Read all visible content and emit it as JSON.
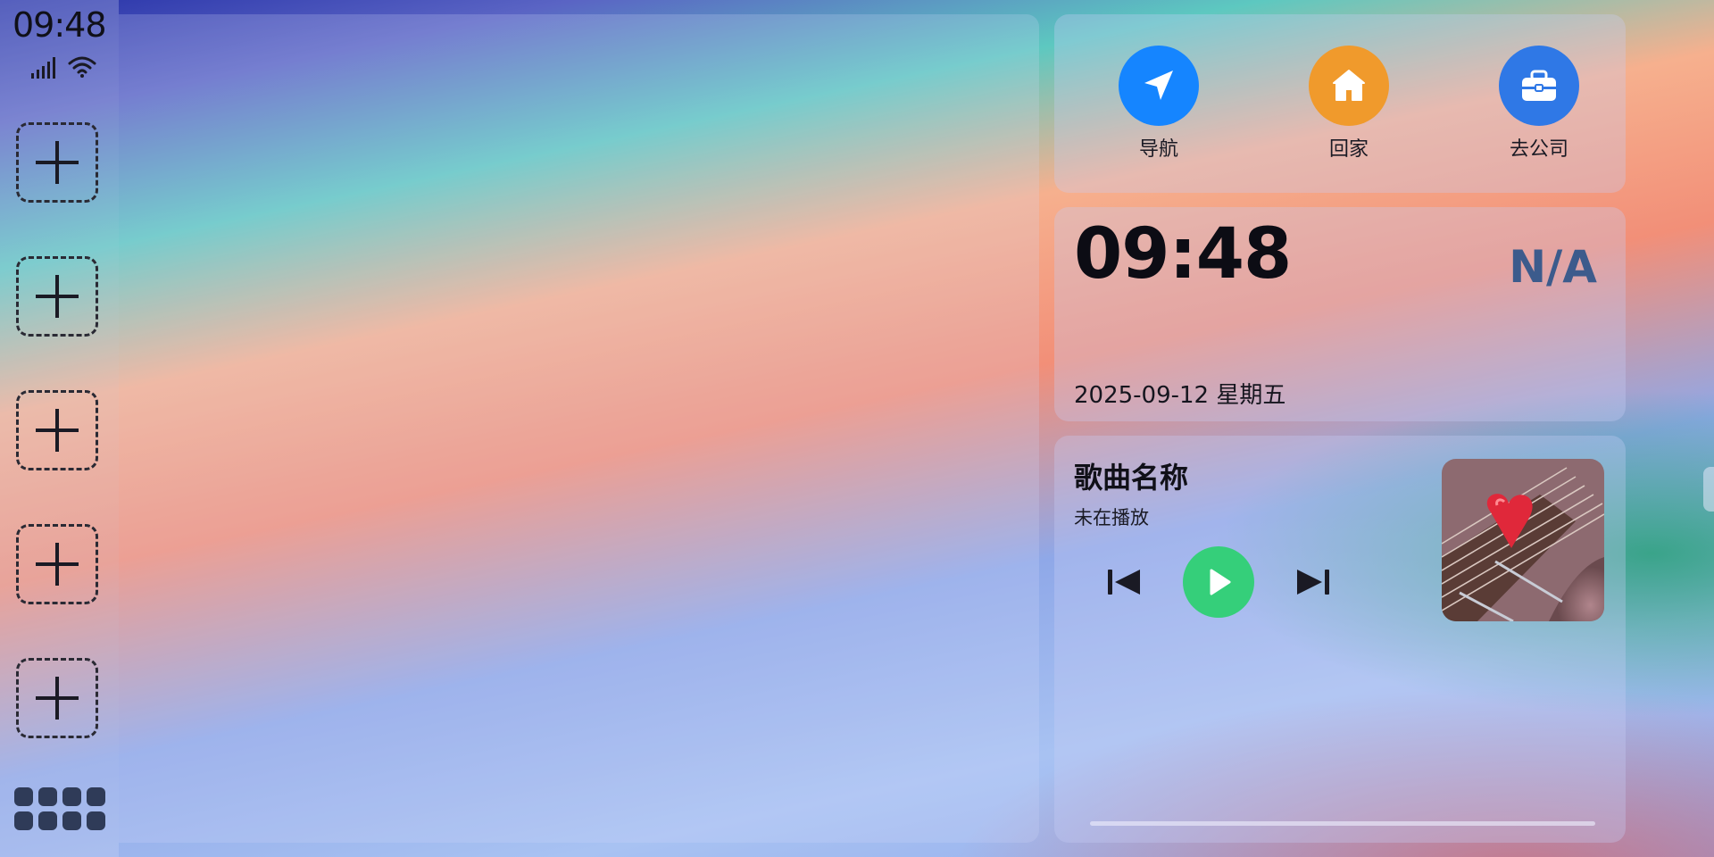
{
  "status_bar": {
    "time": "09:48",
    "icons": [
      "signal-icon",
      "wifi-icon"
    ]
  },
  "dock": {
    "add_slots": 5,
    "apps_button_icon": "app-grid-icon"
  },
  "shortcuts": [
    {
      "label": "导航",
      "icon": "navigation-arrow-icon",
      "color": "#1585ff"
    },
    {
      "label": "回家",
      "icon": "home-icon",
      "color": "#f09a2c"
    },
    {
      "label": "去公司",
      "icon": "briefcase-icon",
      "color": "#2f78e6"
    }
  ],
  "clock": {
    "time": "09:48",
    "weather": "N/A",
    "date": "2025-09-12 星期五"
  },
  "music": {
    "title": "歌曲名称",
    "status": "未在播放",
    "progress": 0,
    "colors": {
      "play": "#35cf7a"
    }
  }
}
